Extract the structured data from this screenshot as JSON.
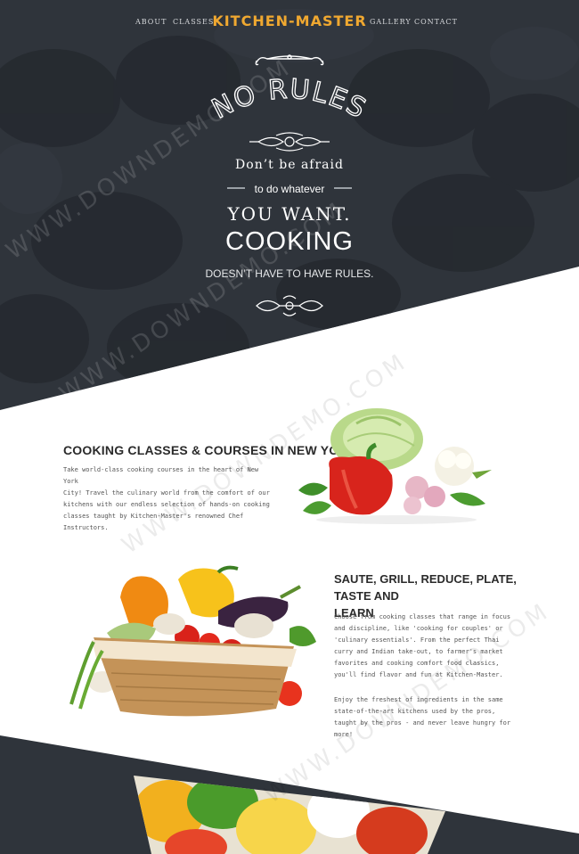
{
  "nav": {
    "about": "ABOUT",
    "classes": "CLASSES",
    "brand": "KITCHEN-MASTER",
    "gallery": "GALLERY",
    "contact": "CONTACT"
  },
  "hero": {
    "title": "NO RULES",
    "line1": "Don’t be afraid",
    "line2": "to do whatever",
    "line3": "YOU WANT.",
    "line4": "COOKING",
    "line5": "DOESN’T HAVE TO HAVE RULES."
  },
  "section1": {
    "title": "COOKING CLASSES & COURSES IN NEW YORK",
    "lines": [
      "Take world-class cooking courses in the heart of New York",
      "City! Travel the culinary world from the comfort of our",
      "kitchens with our endless selection of hands-on cooking",
      "classes taught by Kitchen-Master's renowned Chef",
      "Instructors."
    ]
  },
  "section2": {
    "title_lines": [
      "SAUTE, GRILL, REDUCE, PLATE, TASTE AND",
      "LEARN"
    ],
    "para1": [
      "Choose from cooking classes that range in focus",
      "and discipline, like 'cooking for couples' or",
      "'culinary essentials'. From the perfect Thai",
      "curry and Indian take-out, to farmer's market",
      "favorites and cooking comfort food classics,",
      "you'll find flavor and fun at Kitchen-Master."
    ],
    "para2": [
      "Enjoy the freshest of ingredients in the same",
      "state-of-the-art kitchens used by the pros,",
      "taught by the pros - and never leave hungry for",
      "more!"
    ]
  },
  "watermark": "WWW.DOWNDEMO.COM",
  "colors": {
    "dark": "#2f343b",
    "brand": "#f0a830",
    "text": "#555555"
  },
  "icons": [
    "ornament-top-icon",
    "ornament-mid-icon",
    "ornament-bottom-icon"
  ]
}
